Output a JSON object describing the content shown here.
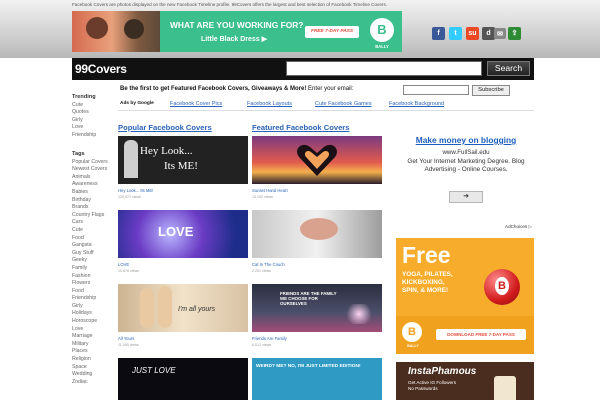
{
  "top": {
    "tagline": "Facebook Covers are photos displayed on the new Facebook Timeline profile. 99Covers offers the largest and best selection of Facebook Timeline Covers."
  },
  "ad_banner": {
    "headline": "WHAT ARE YOU WORKING FOR?",
    "subline": "Little Black Dress ▶",
    "cta": "FREE 7-DAY PASS",
    "logo_letter": "B",
    "logo_text": "BALLY"
  },
  "social": {
    "facebook": "f",
    "twitter": "t",
    "stumbleupon": "su",
    "digg": "d",
    "email": "✉",
    "share": "⇪"
  },
  "nav": {
    "brand": "99Covers",
    "search_button": "Search"
  },
  "promo": {
    "text_bold": "Be the first to get Featured Facebook Covers, Giveaways & More!",
    "text_rest": " Enter your email:",
    "subscribe": "Subscribe"
  },
  "links_bar": {
    "ads_label": "Ads by Google",
    "links": [
      "Facebook Cover Pics",
      "Facebook Layouts",
      "Cute Facebook Games",
      "Facebook Background"
    ]
  },
  "sidebar": {
    "trending_title": "Trending",
    "trending": [
      "Cute",
      "Quotes",
      "Girly",
      "Love",
      "Friendship"
    ],
    "tags_title": "Tags",
    "tags": [
      "Popular Covers",
      "Newest Covers",
      "Animals",
      "Awareness",
      "Babies",
      "Birthday",
      "Brands",
      "Country Flags",
      "Cars",
      "Cute",
      "Food",
      "Gangsta",
      "Guy Stuff",
      "Geeky",
      "Family",
      "Fashion",
      "Flowers",
      "Food",
      "Friendship",
      "Girly",
      "Holidays",
      "Horoscope",
      "Love",
      "Marriage",
      "Military",
      "Places",
      "Religion",
      "Space",
      "Wedding",
      "Zodiac"
    ]
  },
  "sections": {
    "popular": "Popular Facebook Covers",
    "featured": "Featured Facebook Covers"
  },
  "covers": {
    "c1": {
      "title": "Hey Look... Its ME!",
      "views": "120,571 views",
      "image_text_1": "Hey Look...",
      "image_text_2": "Its ME!"
    },
    "c2": {
      "title": "Sunset Hand Heart",
      "views": "13,102 views"
    },
    "c3": {
      "title": "LOVE",
      "views": "10,876 views",
      "image_text": "LOVE"
    },
    "c4": {
      "title": "Cat In The Couch",
      "views": "2,201 views"
    },
    "c5": {
      "title": "All Yours",
      "views": "11,090 views",
      "image_text": "I'm all yours"
    },
    "c6": {
      "title": "Friends Are Family",
      "views": "6,012 views",
      "image_text": "FRIENDS ARE THE FAMILY WE CHOOSE FOR OURSELVES"
    },
    "c7": {
      "image_text": "JUST LOVE"
    },
    "c8": {
      "image_text": "WEIRD? ME? NO, I'M JUST LIMITED EDITION!"
    }
  },
  "right_ad": {
    "title": "Make money on blogging",
    "url": "www.FullSail.edu",
    "body": "Get Your Internet Marketing Degree. Blog Advertising - Online Courses.",
    "arrow": "➜",
    "adchoices": "AdChoices ▷"
  },
  "bally_ad": {
    "free": "Free",
    "lines": [
      "YOGA, PILATES,",
      "KICKBOXING,",
      "SPIN, & MORE!"
    ],
    "logo_letter": "B",
    "logo_text": "BALLY",
    "cta": "DOWNLOAD FREE 7-DAY PASS"
  },
  "insta_ad": {
    "title": "InstaPhamous",
    "sub_1": "Get Active IG Followers",
    "sub_2": "No Passwords"
  },
  "colors": {
    "link": "#2a63b8",
    "navbar": "#111111",
    "ad_green": "#3bbf8d",
    "bally_orange": "#f7ad2b"
  }
}
